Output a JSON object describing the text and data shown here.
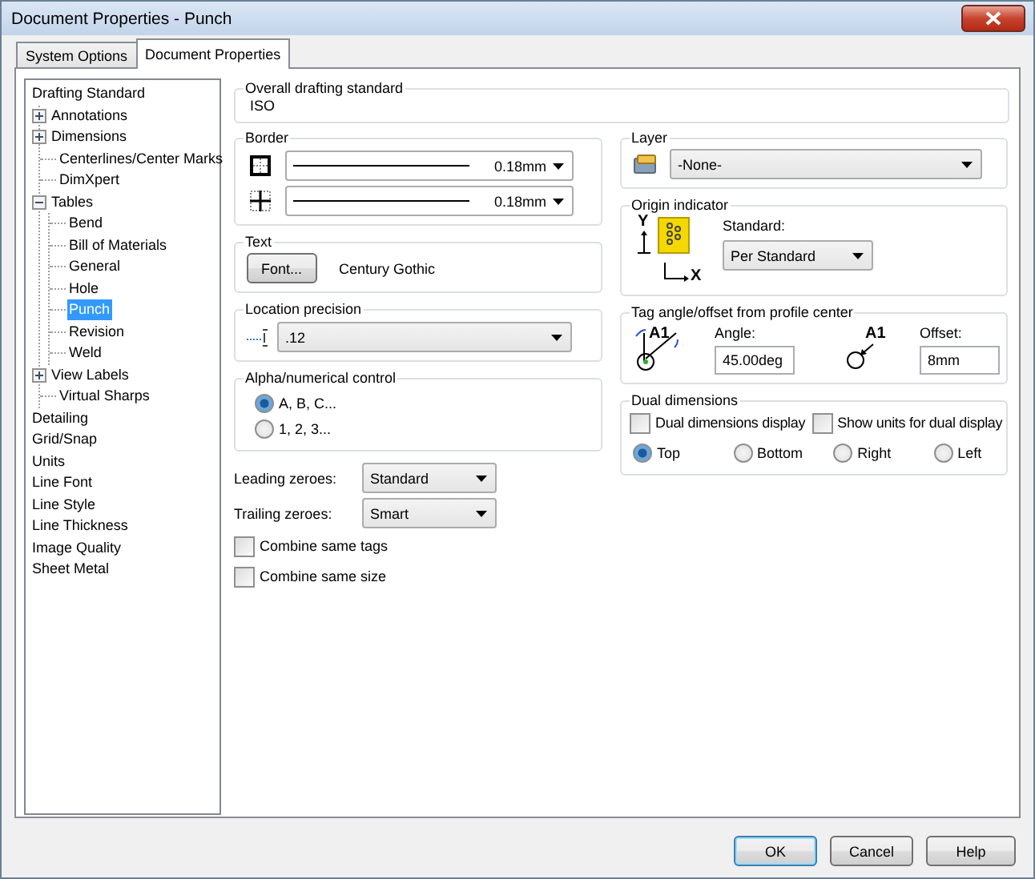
{
  "window": {
    "title": "Document Properties - Punch"
  },
  "tabs": [
    {
      "label": "System Options",
      "selected": false
    },
    {
      "label": "Document Properties",
      "selected": true
    }
  ],
  "tree": [
    {
      "label": "Drafting Standard",
      "selected": false,
      "children": [
        {
          "label": "Annotations",
          "selected": false,
          "expanded": false
        },
        {
          "label": "Dimensions",
          "selected": false,
          "expanded": false
        },
        {
          "label": "Centerlines/Center Marks",
          "selected": false
        },
        {
          "label": "DimXpert",
          "selected": false
        },
        {
          "label": "Tables",
          "selected": false,
          "expanded": true,
          "children": [
            {
              "label": "Bend",
              "selected": false
            },
            {
              "label": "Bill of Materials",
              "selected": false
            },
            {
              "label": "General",
              "selected": false
            },
            {
              "label": "Hole",
              "selected": false
            },
            {
              "label": "Punch",
              "selected": true
            },
            {
              "label": "Revision",
              "selected": false
            },
            {
              "label": "Weld",
              "selected": false
            }
          ]
        },
        {
          "label": "View Labels",
          "selected": false,
          "expanded": false
        },
        {
          "label": "Virtual Sharps",
          "selected": false
        }
      ]
    },
    {
      "label": "Detailing",
      "selected": false
    },
    {
      "label": "Grid/Snap",
      "selected": false
    },
    {
      "label": "Units",
      "selected": false
    },
    {
      "label": "Line Font",
      "selected": false
    },
    {
      "label": "Line Style",
      "selected": false
    },
    {
      "label": "Line Thickness",
      "selected": false
    },
    {
      "label": "Image Quality",
      "selected": false
    },
    {
      "label": "Sheet Metal",
      "selected": false
    }
  ],
  "overall_drafting_standard": {
    "label": "Overall drafting standard",
    "value": "ISO"
  },
  "border": {
    "label": "Border",
    "rows": [
      {
        "kind": "outer",
        "value": "0.18mm"
      },
      {
        "kind": "inner",
        "value": "0.18mm"
      }
    ]
  },
  "text": {
    "label": "Text",
    "button": "Font...",
    "font": "Century Gothic"
  },
  "location_precision": {
    "label": "Location precision",
    "value": ".12"
  },
  "alpha_numerical_control": {
    "label": "Alpha/numerical control",
    "options": [
      {
        "label": "A, B, C...",
        "selected": true
      },
      {
        "label": "1, 2, 3...",
        "selected": false
      }
    ]
  },
  "zeroes": [
    {
      "label": "Leading zeroes:",
      "value": "Standard"
    },
    {
      "label": "Trailing zeroes:",
      "value": "Smart"
    }
  ],
  "options": [
    {
      "label": "Combine same tags",
      "checked": false
    },
    {
      "label": "Combine same size",
      "checked": false
    }
  ],
  "layer": {
    "label": "Layer",
    "value": "-None-"
  },
  "origin_indicator": {
    "label": "Origin indicator",
    "y_label": "Y",
    "x_label": "X",
    "standard_label": "Standard:",
    "value": "Per Standard"
  },
  "tag_angle_offset": {
    "label": "Tag angle/offset from profile center",
    "angle_tag": "A1",
    "angle_label": "Angle:",
    "angle": "45.00deg",
    "offset_tag": "A1",
    "offset_label": "Offset:",
    "offset": "8mm"
  },
  "dual_dimensions": {
    "label": "Dual dimensions",
    "options": [
      {
        "label": "Dual dimensions display",
        "checked": false
      },
      {
        "label": "Show units for dual display",
        "checked": false
      }
    ],
    "positions": [
      {
        "label": "Top",
        "selected": true
      },
      {
        "label": "Bottom",
        "selected": false
      },
      {
        "label": "Right",
        "selected": false
      },
      {
        "label": "Left",
        "selected": false
      }
    ]
  },
  "buttons": [
    {
      "label": "OK",
      "default": true
    },
    {
      "label": "Cancel",
      "default": false
    },
    {
      "label": "Help",
      "default": false
    }
  ]
}
